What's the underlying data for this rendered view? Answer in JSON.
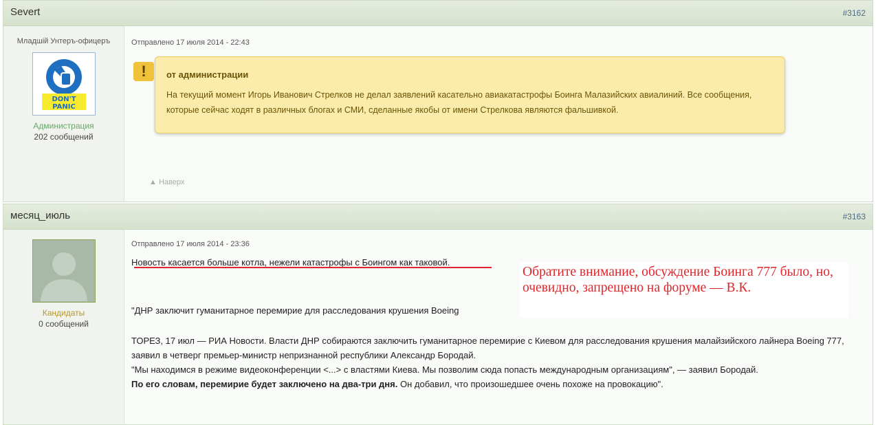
{
  "posts": [
    {
      "author": "Severt",
      "number": "#3162",
      "rank": "Младшiй Унтеръ-офицеръ",
      "group": "Администрация",
      "message_count": "202 сообщений",
      "posted": "Отправлено 17 июля 2014 - 22:43",
      "notice": {
        "icon": "!",
        "title": "от администрации",
        "text": "На текущий момент Игорь Иванович Стрелков не делал заявлений касательно авиакатастрофы Боинга Малазийских авиалиний. Все сообщения, которые сейчас ходят в различных блогах и СМИ, сделанные якобы от имени Стрелкова являются фальшивкой."
      },
      "back_to_top": "Наверх",
      "avatar_icon": "dont-panic-logo",
      "avatar_text1": "DON'T",
      "avatar_text2": "PANIC"
    },
    {
      "author": "месяц_июль",
      "number": "#3163",
      "group": "Кандидаты",
      "message_count": "0 сообщений",
      "posted": "Отправлено 17 июля 2014 - 23:36",
      "line1": "Новость касается больше котла, нежели катастрофы с Боингом как таковой.",
      "annotation": "Обратите внимание, обсуждение Боинга 777 было, но, очевидно, запрещено на форуме — В.К.",
      "quote_title": "\"ДНР заключит гуманитарное перемирие для расследования крушения Boeing",
      "para1": "ТОРЕЗ, 17 июл — РИА Новости. Власти ДНР собираются заключить гуманитарное перемирие с Киевом для расследования крушения малайзийского лайнера Boeing 777, заявил в четверг премьер-министр непризнанной республики Александр Бородай.",
      "para2": "\"Мы находимся в режиме видеоконференции <...> с властями Киева. Мы позволим сюда попасть международным организациям\", — заявил Бородай.",
      "para3_bold": "По его словам, перемирие будет заключено на два-три дня.",
      "para3_rest": " Он добавил, что произошедшее очень похоже на провокацию\".",
      "avatar_icon": "default-avatar-silhouette"
    }
  ],
  "colors": {
    "header_bg": "#dbe5d3",
    "notice_bg": "#fcecab",
    "annotation_red": "#e0262b",
    "group_admin": "#6aa56a",
    "group_candidate": "#b4962e"
  }
}
